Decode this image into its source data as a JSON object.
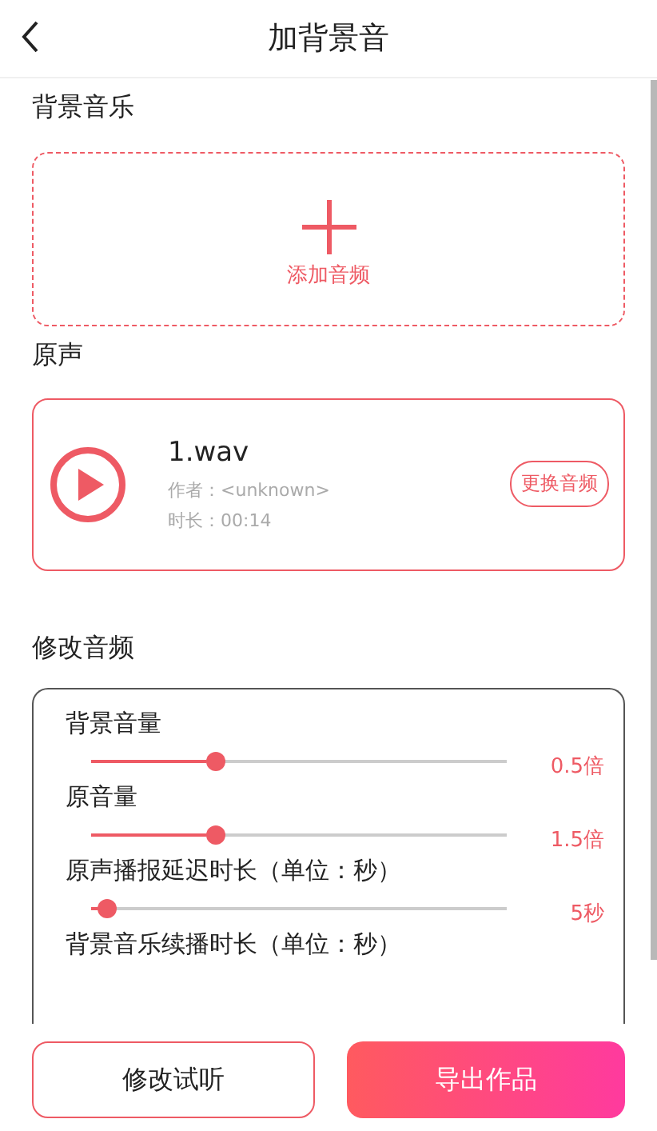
{
  "header": {
    "title": "加背景音"
  },
  "background_music": {
    "heading": "背景音乐",
    "add_label": "添加音频"
  },
  "original": {
    "heading": "原声",
    "file_name": "1.wav",
    "author": "作者：<unknown>",
    "duration": "时长：00:14",
    "replace_button": "更换音频"
  },
  "edit": {
    "heading": "修改音频",
    "settings": [
      {
        "label": "背景音量",
        "level": 0.3,
        "reading": "0.5倍"
      },
      {
        "label": "原音量",
        "level": 0.3,
        "reading": "1.5倍"
      },
      {
        "label": "原声播报延迟时长（单位：秒）",
        "level": 0.04,
        "reading": "5秒"
      },
      {
        "label": "背景音乐续播时长（单位：秒）"
      }
    ]
  },
  "footer": {
    "preview_button": "修改试听",
    "export_button": "导出作品"
  }
}
